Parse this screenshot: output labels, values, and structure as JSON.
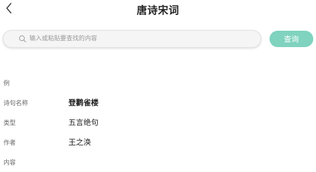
{
  "header": {
    "title": "唐诗宋词"
  },
  "search": {
    "placeholder": "输入或粘贴要查找的内容",
    "value": "",
    "button_label": "查询"
  },
  "example": {
    "label": "例"
  },
  "details": [
    {
      "label": "诗句名称",
      "value": "登鹳雀楼"
    },
    {
      "label": "类型",
      "value": "五言绝句"
    },
    {
      "label": "作者",
      "value": "王之涣"
    },
    {
      "label": "内容",
      "value": ""
    }
  ],
  "colors": {
    "accent": "#7fd3bf"
  },
  "icons": {
    "back": "chevron-left-icon",
    "search": "search-icon"
  }
}
